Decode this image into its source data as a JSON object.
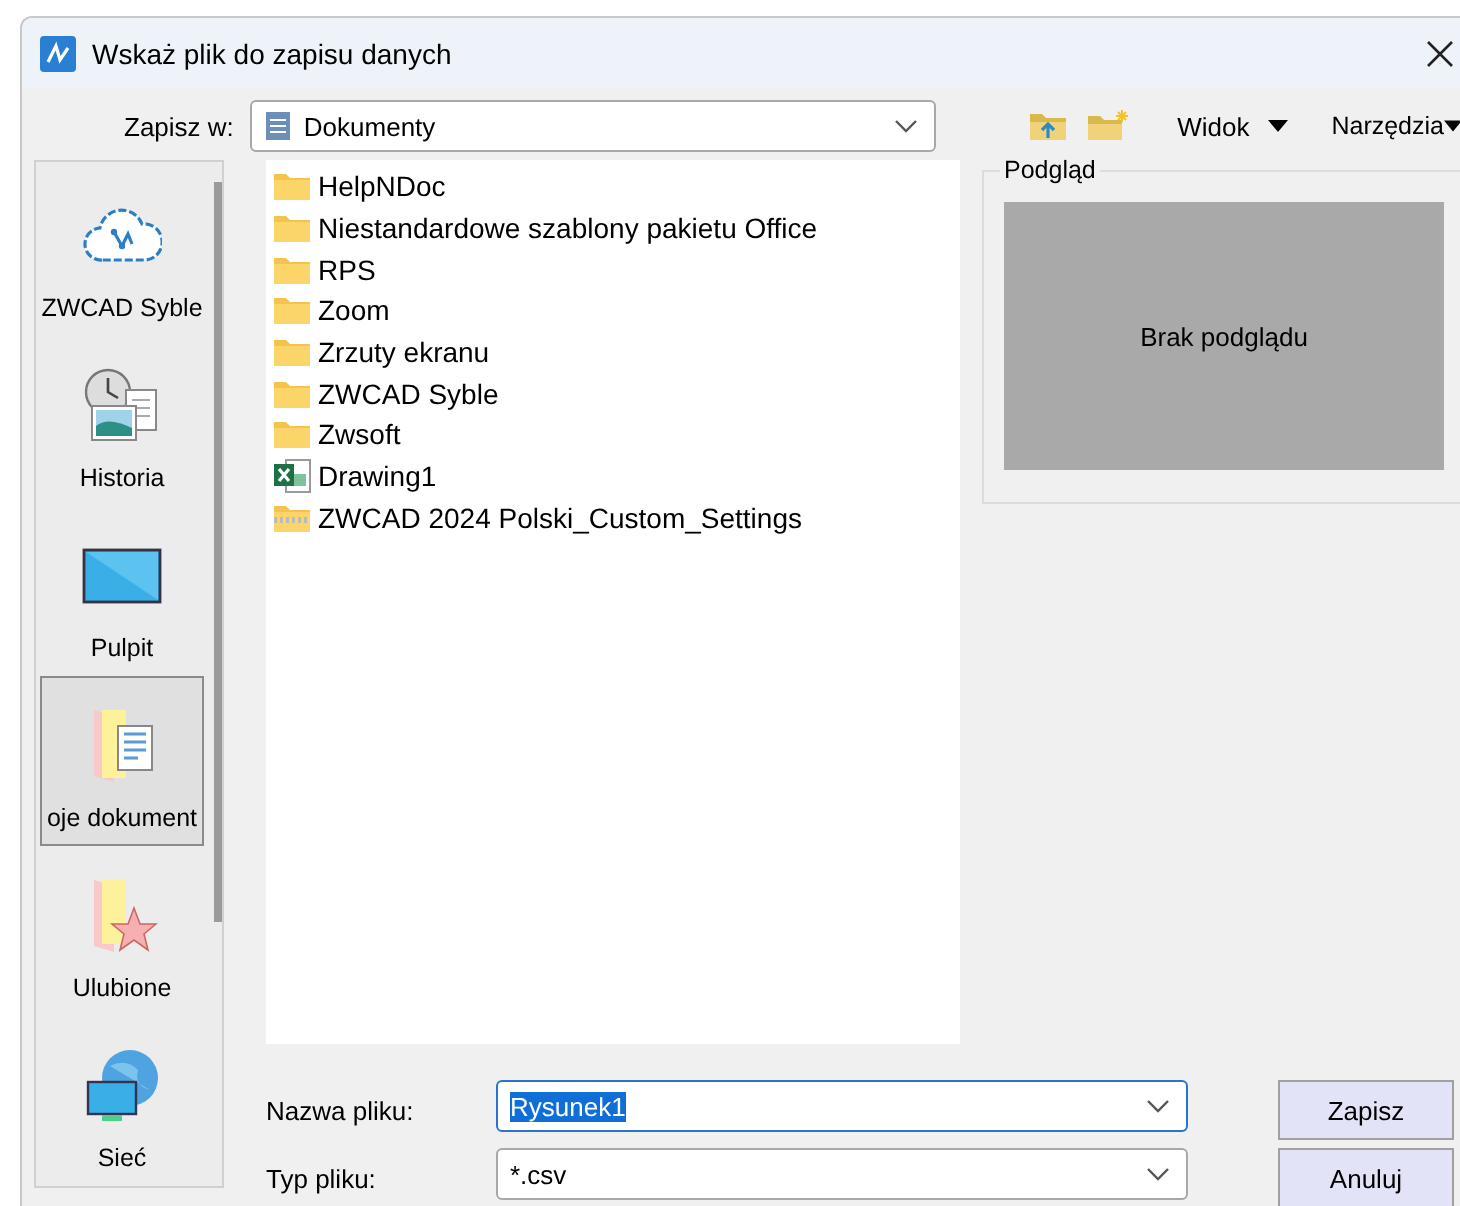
{
  "window": {
    "title": "Wskaż plik do zapisu danych"
  },
  "save_in": {
    "label": "Zapisz w:",
    "value": "Dokumenty"
  },
  "toolbar": {
    "view": "Widok",
    "tools": "Narzędzia"
  },
  "places": [
    {
      "label": "ZWCAD Syble",
      "kind": "cloud",
      "selected": false
    },
    {
      "label": "Historia",
      "kind": "history",
      "selected": false
    },
    {
      "label": "Pulpit",
      "kind": "desktop",
      "selected": false
    },
    {
      "label": "oje dokument",
      "kind": "documents",
      "selected": true
    },
    {
      "label": "Ulubione",
      "kind": "favorites",
      "selected": false
    },
    {
      "label": "Sieć",
      "kind": "network",
      "selected": false
    }
  ],
  "files": [
    {
      "name": "HelpNDoc",
      "kind": "folder"
    },
    {
      "name": "Niestandardowe szablony pakietu Office",
      "kind": "folder"
    },
    {
      "name": "RPS",
      "kind": "folder"
    },
    {
      "name": "Zoom",
      "kind": "folder"
    },
    {
      "name": "Zrzuty ekranu",
      "kind": "folder"
    },
    {
      "name": "ZWCAD Syble",
      "kind": "folder"
    },
    {
      "name": "Zwsoft",
      "kind": "folder"
    },
    {
      "name": "Drawing1",
      "kind": "spreadsheet"
    },
    {
      "name": "ZWCAD 2024 Polski_Custom_Settings",
      "kind": "archive"
    }
  ],
  "preview": {
    "title": "Podgląd",
    "message": "Brak podglądu"
  },
  "file_name": {
    "label": "Nazwa pliku:",
    "value": "Rysunek1",
    "text_selected": true
  },
  "file_type": {
    "label": "Typ pliku:",
    "value": "*.csv"
  },
  "buttons": [
    "Zapisz",
    "Anuluj"
  ]
}
